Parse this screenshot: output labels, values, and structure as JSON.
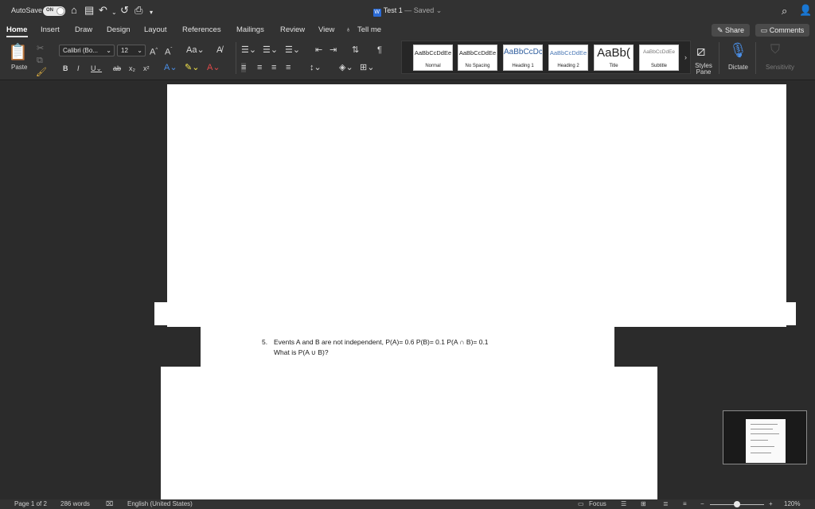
{
  "titlebar": {
    "autosave_label": "AutoSave",
    "autosave_state": "ON",
    "doc_name": "Test 1",
    "doc_status": "— Saved",
    "icons": [
      "home-icon",
      "save-icon",
      "undo-icon",
      "redo-icon",
      "print-icon",
      "customize-icon",
      "search-icon",
      "profile-icon"
    ]
  },
  "tabs": [
    "Home",
    "Insert",
    "Draw",
    "Design",
    "Layout",
    "References",
    "Mailings",
    "Review",
    "View"
  ],
  "tell_me": "Tell me",
  "share_label": "Share",
  "comments_label": "Comments",
  "ribbon": {
    "paste_label": "Paste",
    "font_name": "Calibri (Bo...",
    "font_size": "12",
    "styles": [
      {
        "sample": "AaBbCcDdEe",
        "name": "Normal"
      },
      {
        "sample": "AaBbCcDdEe",
        "name": "No Spacing"
      },
      {
        "sample": "AaBbCcDc",
        "name": "Heading 1"
      },
      {
        "sample": "AaBbCcDdEe",
        "name": "Heading 2"
      },
      {
        "sample": "AaBb(",
        "name": "Title"
      },
      {
        "sample": "AaBbCcDdEe",
        "name": "Subtitle"
      }
    ],
    "styles_pane_label": "Styles Pane",
    "dictate_label": "Dictate",
    "sensitivity_label": "Sensitivity"
  },
  "document": {
    "question_number": "5.",
    "question_line1": "Events A and B are not independent, P(A)= 0.6 P(B)= 0.1 P(A ∩ B)= 0.1",
    "question_line2": "What is P(A ∪ B)?"
  },
  "status": {
    "page": "Page 1 of 2",
    "words": "286 words",
    "language": "English (United States)",
    "focus": "Focus",
    "zoom": "120%",
    "zoom_level": 0.5
  },
  "colors": {
    "chrome": "#323232",
    "canvas": "#2b2b2b",
    "accent_blue": "#2b6bd6"
  }
}
